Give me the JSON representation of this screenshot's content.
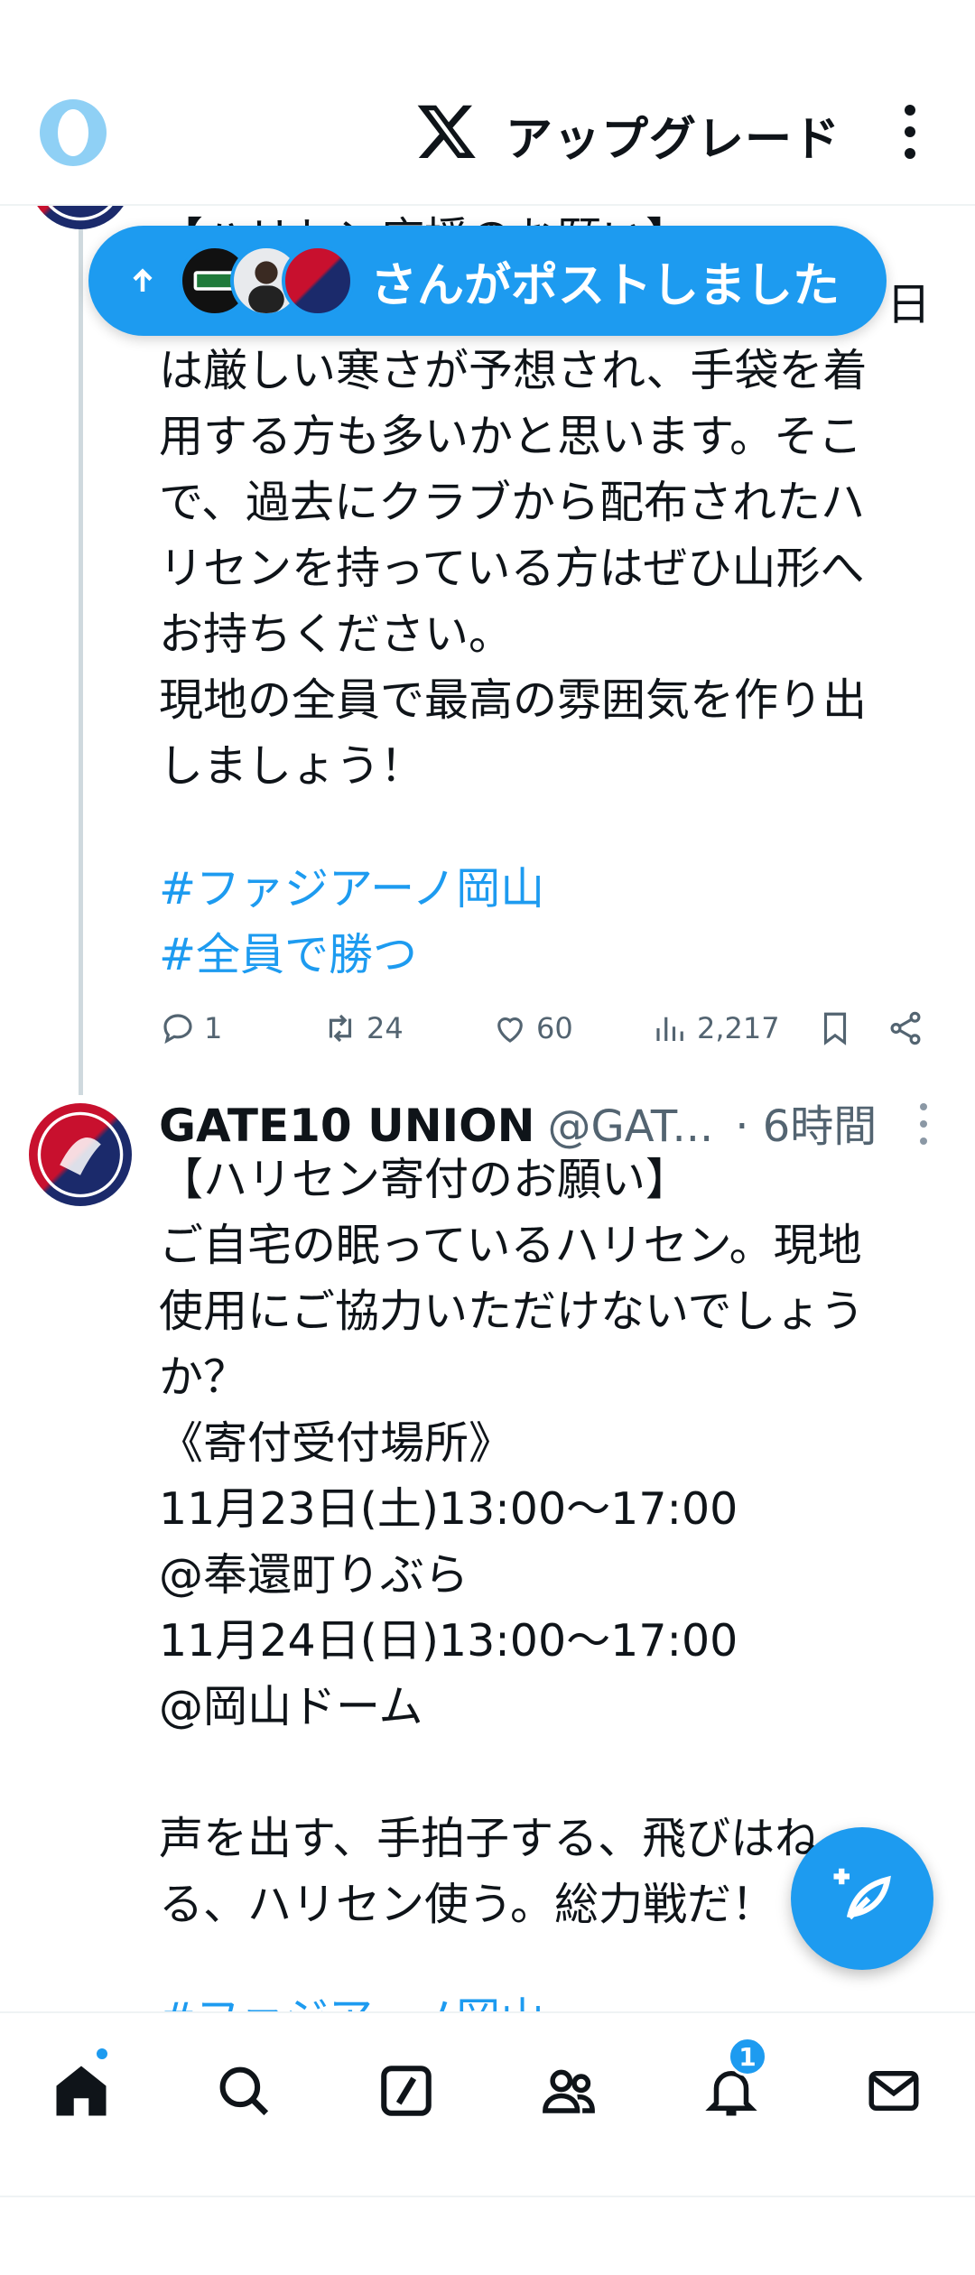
{
  "header": {
    "upgrade_label": "アップグレード"
  },
  "new_posts_pill": {
    "label": "さんがポストしました"
  },
  "tweet1": {
    "partial_top_text": "【ハリセン応援のお願い】",
    "partial_second_line": "日",
    "body": "は厳しい寒さが予想され、手袋を着\n用する方も多いかと思います。そこ\nで、過去にクラブから配布されたハ\nリセンを持っている方はぜひ山形へ\nお持ちください。\n現地の全員で最高の雰囲気を作り出\nしましょう！",
    "hashtags": [
      "#ファジアーノ岡山",
      "#全員で勝つ"
    ],
    "stats": {
      "replies": "1",
      "reposts": "24",
      "likes": "60",
      "views": "2,217"
    }
  },
  "tweet2": {
    "name": "GATE10 UNION",
    "handle": "@GAT...",
    "time": "· 6時間",
    "body": "【ハリセン寄付のお願い】\nご自宅の眠っているハリセン。現地\n使用にご協力いただけないでしょう\nか？\n《寄付受付場所》\n11月23日(土)13:00〜17:00\n@奉還町りぶら\n11月24日(日)13:00〜17:00\n@岡山ドーム\n\n声を出す、手拍子する、飛びはね\nる、ハリセン使う。総力戦だ！",
    "partial_hashtag": "#ファジアーノ岡山"
  },
  "bottom_nav": {
    "notifications_badge": "1",
    "items": [
      "home-icon",
      "search-icon",
      "grok-icon",
      "communities-icon",
      "notifications-icon",
      "messages-icon"
    ]
  },
  "colors": {
    "accent": "#1d9bf0",
    "text": "#0f1419",
    "secondary": "#536471"
  }
}
